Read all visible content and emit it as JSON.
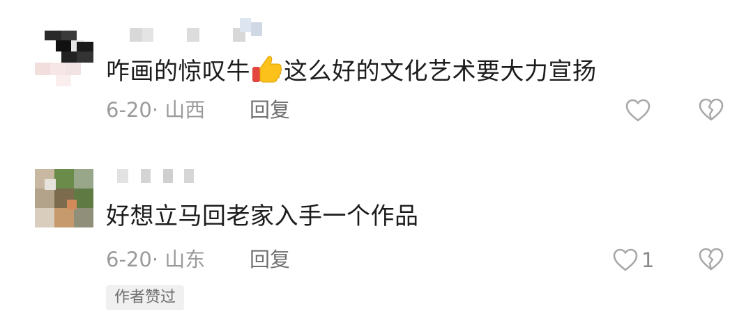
{
  "comments": [
    {
      "text_before_emoji": "咋画的惊叹牛",
      "emoji": "thumbs-up",
      "text_after_emoji": "这么好的文化艺术要大力宣扬",
      "date": "6-20",
      "location": "· 山西",
      "reply_label": "回复",
      "like_count": ""
    },
    {
      "text": "好想立马回老家入手一个作品",
      "date": "6-20",
      "location": "· 山东",
      "reply_label": "回复",
      "like_count": "1",
      "badge": "作者赞过"
    }
  ],
  "colors": {
    "text": "#1c1c1c",
    "meta": "#9a9a9a",
    "icon_stroke": "#a8a8a8",
    "badge_bg": "#f0f0f0"
  },
  "icons": [
    "heart-outline-icon",
    "broken-heart-icon",
    "thumbs-up-emoji"
  ]
}
